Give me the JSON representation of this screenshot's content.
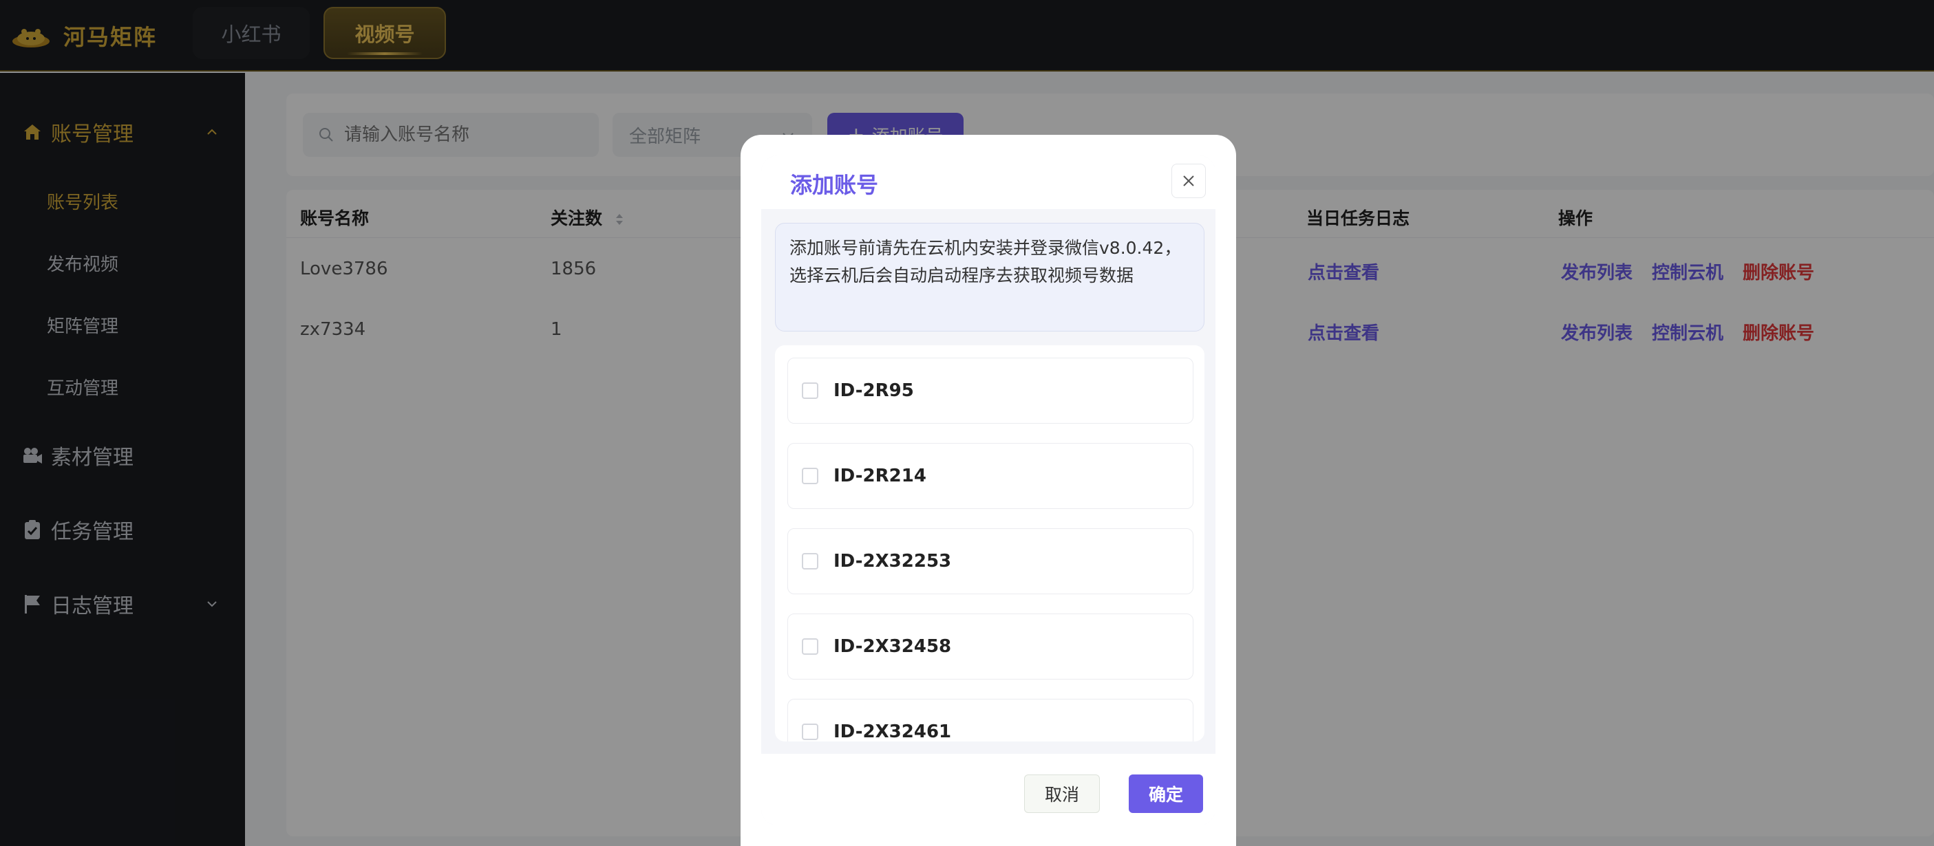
{
  "header": {
    "logo_text": "河马矩阵",
    "tabs": [
      {
        "label": "小红书"
      },
      {
        "label": "视频号"
      }
    ]
  },
  "sidebar": {
    "groups": [
      {
        "label": "账号管理",
        "icon": "home-icon"
      },
      {
        "label": "素材管理",
        "icon": "camera-icon"
      },
      {
        "label": "任务管理",
        "icon": "clipboard-icon"
      },
      {
        "label": "日志管理",
        "icon": "flag-icon"
      }
    ],
    "subitems": [
      {
        "label": "账号列表"
      },
      {
        "label": "发布视频"
      },
      {
        "label": "矩阵管理"
      },
      {
        "label": "互动管理"
      }
    ]
  },
  "toolbar": {
    "search_placeholder": "请输入账号名称",
    "select_value": "全部矩阵",
    "add_button": "添加账号"
  },
  "table": {
    "columns": [
      "账号名称",
      "关注数",
      "当日任务日志",
      "操作"
    ],
    "rows": [
      {
        "name": "Love3786",
        "followers": "1856",
        "log": "点击查看",
        "actions": [
          "发布列表",
          "控制云机",
          "删除账号"
        ]
      },
      {
        "name": "zx7334",
        "followers": "1",
        "log": "点击查看",
        "actions": [
          "发布列表",
          "控制云机",
          "删除账号"
        ]
      }
    ]
  },
  "modal": {
    "title": "添加账号",
    "notice": "添加账号前请先在云机内安装并登录微信v8.0.42，选择云机后会自动启动程序去获取视频号数据",
    "items": [
      {
        "label": "ID-2R95"
      },
      {
        "label": "ID-2R214"
      },
      {
        "label": "ID-2X32253"
      },
      {
        "label": "ID-2X32458"
      },
      {
        "label": "ID-2X32461"
      }
    ],
    "cancel": "取消",
    "confirm": "确定"
  },
  "colors": {
    "brand_gold": "#d6ac3a",
    "accent_purple": "#6b5ce7",
    "danger_red": "#e4393c",
    "dark_bg": "#1a1c20"
  }
}
